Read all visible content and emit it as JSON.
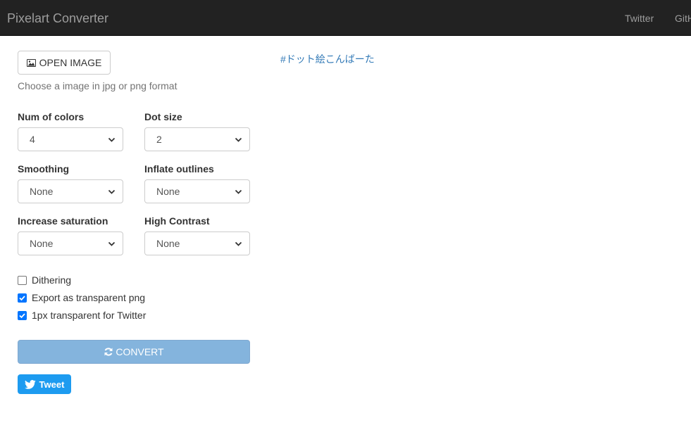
{
  "navbar": {
    "brand": "Pixelart Converter",
    "links": [
      "Twitter",
      "GitHub"
    ]
  },
  "upload": {
    "button_label": "OPEN IMAGE",
    "button_icon": "picture-icon",
    "help_text": "Choose a image in jpg or png format"
  },
  "settings": {
    "num_colors": {
      "label": "Num of colors",
      "value": "4"
    },
    "dot_size": {
      "label": "Dot size",
      "value": "2"
    },
    "smoothing": {
      "label": "Smoothing",
      "value": "None"
    },
    "inflate_outlines": {
      "label": "Inflate outlines",
      "value": "None"
    },
    "increase_saturation": {
      "label": "Increase saturation",
      "value": "None"
    },
    "high_contrast": {
      "label": "High Contrast",
      "value": "None"
    }
  },
  "options": {
    "dithering": {
      "label": "Dithering",
      "checked": false
    },
    "export_transparent": {
      "label": "Export as transparent png",
      "checked": true
    },
    "twitter_transparent": {
      "label": "1px transparent for Twitter",
      "checked": true
    }
  },
  "actions": {
    "convert_label": "CONVERT",
    "convert_icon": "refresh-icon",
    "tweet_label": "Tweet",
    "tweet_icon": "twitter-bird-icon"
  },
  "hashtag": "#ドット絵こんばーた",
  "colors": {
    "navbar_bg": "#222222",
    "convert_bg": "#84b4dd",
    "tweet_bg": "#1d9bf0",
    "link": "#337ab7",
    "checkbox_checked": "#0075ff"
  }
}
